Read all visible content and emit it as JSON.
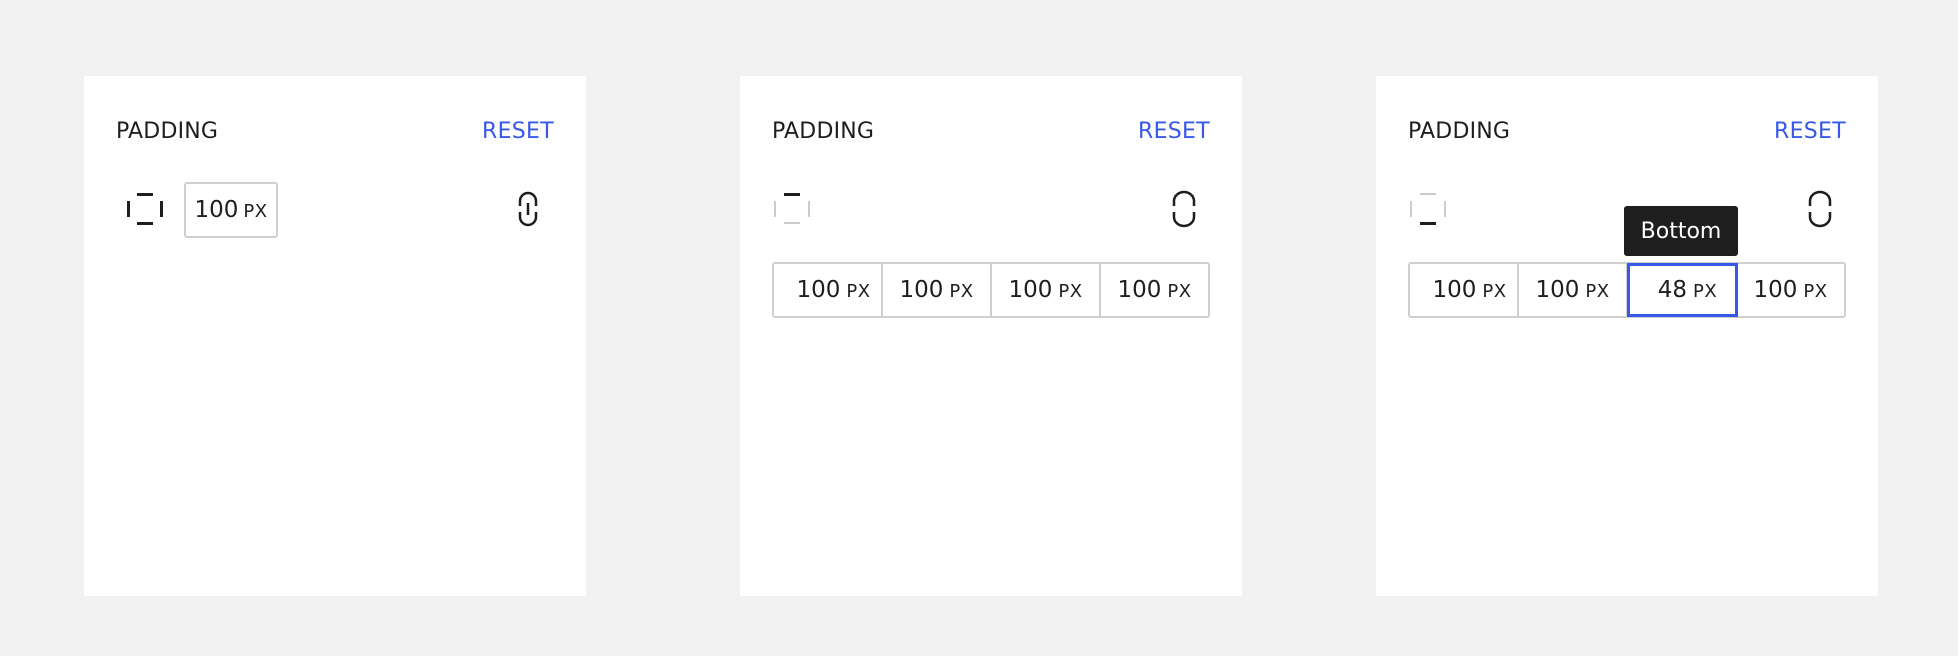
{
  "panels": [
    {
      "title": "PADDING",
      "reset_label": "RESET",
      "side_icon": "all-sides-icon",
      "link_icon": "link-icon",
      "linked": true,
      "value": "100",
      "unit": "PX"
    },
    {
      "title": "PADDING",
      "reset_label": "RESET",
      "side_icon": "top-side-icon",
      "link_icon": "unlink-icon",
      "linked": false,
      "inputs": [
        {
          "value": "100",
          "unit": "PX"
        },
        {
          "value": "100",
          "unit": "PX"
        },
        {
          "value": "100",
          "unit": "PX"
        },
        {
          "value": "100",
          "unit": "PX"
        }
      ]
    },
    {
      "title": "PADDING",
      "reset_label": "RESET",
      "side_icon": "bottom-side-icon",
      "link_icon": "unlink-icon",
      "linked": false,
      "tooltip": "Bottom",
      "focused_index": 2,
      "inputs": [
        {
          "value": "100",
          "unit": "PX"
        },
        {
          "value": "100",
          "unit": "PX"
        },
        {
          "value": "48",
          "unit": "PX"
        },
        {
          "value": "100",
          "unit": "PX"
        }
      ]
    }
  ],
  "colors": {
    "accent": "#3858e9",
    "text": "#1e1e1e",
    "border": "#cfcfcf",
    "background": "#f1f1f1",
    "tooltip_bg": "#1e1e1e"
  }
}
